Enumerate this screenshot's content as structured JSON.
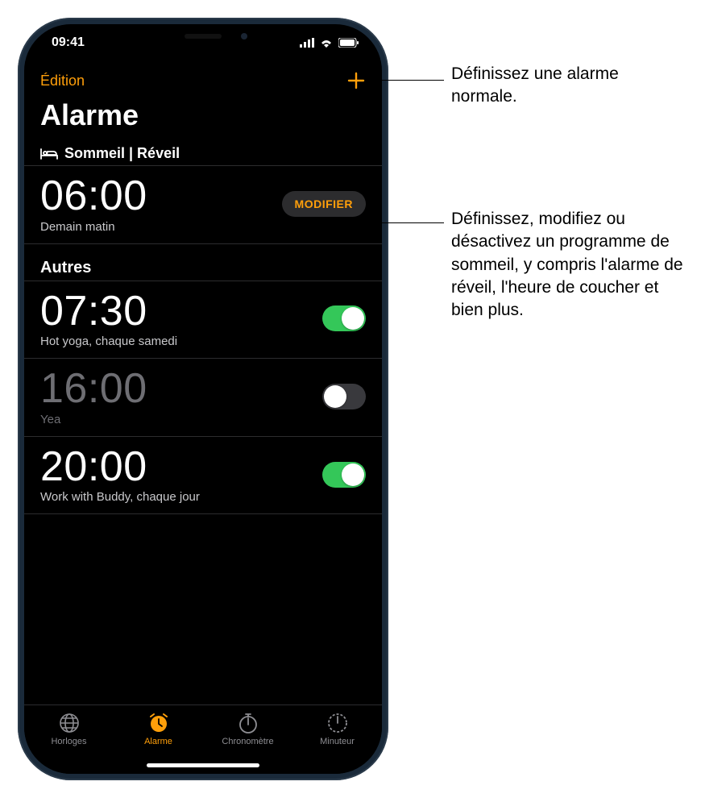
{
  "status": {
    "time": "09:41"
  },
  "nav": {
    "edit": "Édition"
  },
  "title": "Alarme",
  "sleep": {
    "header": "Sommeil | Réveil",
    "time": "06:00",
    "sub": "Demain matin",
    "modify": "MODIFIER"
  },
  "others_header": "Autres",
  "alarms": [
    {
      "time": "07:30",
      "label": "Hot yoga, chaque samedi",
      "on": true
    },
    {
      "time": "16:00",
      "label": "Yea",
      "on": false
    },
    {
      "time": "20:00",
      "label": "Work with Buddy, chaque jour",
      "on": true
    }
  ],
  "tabs": [
    {
      "label": "Horloges",
      "icon": "globe",
      "active": false
    },
    {
      "label": "Alarme",
      "icon": "alarm",
      "active": true
    },
    {
      "label": "Chronomètre",
      "icon": "stopwatch",
      "active": false
    },
    {
      "label": "Minuteur",
      "icon": "timer",
      "active": false
    }
  ],
  "callouts": {
    "add": "Définissez une alarme normale.",
    "modify": "Définissez, modifiez ou désactivez un programme de sommeil, y compris l'alarme de réveil, l'heure de coucher et bien plus."
  }
}
